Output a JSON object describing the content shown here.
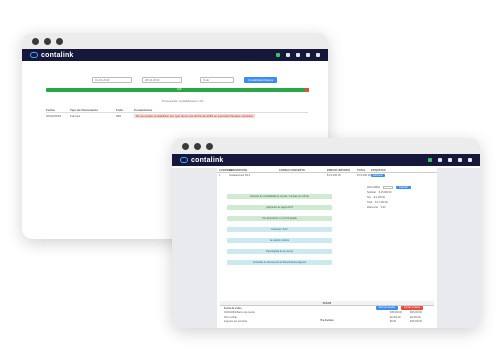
{
  "brand": {
    "name": "contalink"
  },
  "back_window": {
    "filters": {
      "date_from": "01-02-2019",
      "date_to": "28-02-2019",
      "select": "Todo",
      "button": "Contabilidad Masiva"
    },
    "progress": {
      "percent": 100,
      "label": "100"
    },
    "status": "Procesando contabilización 1/1",
    "table": {
      "headers": [
        "Fecha",
        "Tipo de Documento",
        "Folio",
        "Comentarios"
      ],
      "rows": [
        [
          "20/02/2019",
          "Factura",
          "950",
          "No se puede contabilizar por que tiene una fecha de 2019 en periodos fiscales cerrados"
        ]
      ]
    }
  },
  "front_window": {
    "table": {
      "headers": [
        "CANTIDAD",
        "DESCRIPCIÓN",
        "CODIGO CONCEPTO",
        "PRECIO UNITARIO",
        "TOTAL",
        "ETIQUETAS"
      ],
      "rows": [
        [
          "1",
          "Instalaciones 6/13",
          "",
          "$ 15,000.00",
          "$ 15,000.00",
          "Facturar"
        ]
      ]
    },
    "pills": [
      {
        "label": "Asientos de contabilidad de ventas / cuentas por cobrar",
        "tone": "green"
      },
      {
        "label": "Aplicación de pagos 6/13",
        "tone": "green"
      },
      {
        "label": "Pre-facturación / ver 6/13 detalle",
        "tone": "green"
      },
      {
        "label": "Facturas / 6/13",
        "tone": "teal"
      },
      {
        "label": "La relación cobros",
        "tone": "teal"
      },
      {
        "label": "Descargada de la cuenta",
        "tone": "teal"
      },
      {
        "label": "Consultar de Documento de Beneficiarios Algunos",
        "tone": "teal"
      }
    ],
    "side": {
      "label": "APLICABLE",
      "button": "Guardar",
      "subtotal_label": "Subtotal",
      "subtotal": "$ 15,000.00",
      "iva_label": "IVA",
      "iva": "$ 2,400.00",
      "total_label": "Total",
      "total": "$ 17,400.00",
      "pending_label": "Diferencia",
      "pending": "0.00"
    },
    "bottom": {
      "title": "PAGOS",
      "headers": [
        "Fecha de cobro",
        "DEBE",
        "HABER"
      ],
      "rows": [
        [
          "15/02/2019 Banco de cuenta",
          "$15,000.00",
          "$15,000.00"
        ],
        [
          "IVA a cobrar",
          "$2,400.00",
          "$2,400.00"
        ],
        [
          "Ingresos por servicios",
          "$0.00",
          "$15,000.00"
        ]
      ],
      "buttons": {
        "save": "Abrir proveedor",
        "cancel": "Cerrar ventana"
      },
      "footer": "Pre-Factura"
    }
  }
}
